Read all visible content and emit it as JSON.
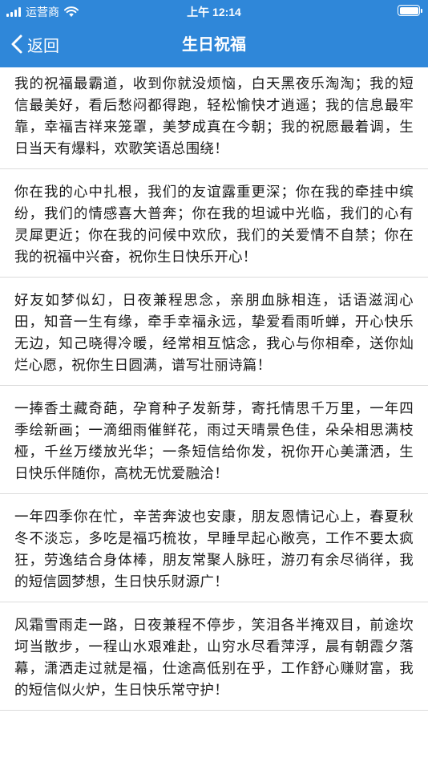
{
  "status_bar": {
    "carrier": "运营商",
    "time": "上午 12:14",
    "icons": [
      "signal-icon",
      "wifi-icon",
      "battery-icon"
    ]
  },
  "nav": {
    "back_label": "返回",
    "title": "生日祝福",
    "icons": [
      "chevron-left-icon"
    ]
  },
  "colors": {
    "accent": "#2f87d9",
    "text": "#1b1b1b",
    "divider": "#dcdcdc"
  },
  "messages": [
    "我的祝福最霸道，收到你就没烦恼，白天黑夜乐淘淘；我的短信最美好，看后愁闷都得跑，轻松愉快才逍遥；我的信息最牢靠，幸福吉祥来笼罩，美梦成真在今朝；我的祝愿最着调，生日当天有爆料，欢歌笑语总围绕！",
    "你在我的心中扎根，我们的友谊露重更深；你在我的牵挂中缤纷，我们的情感喜大普奔；你在我的坦诚中光临，我们的心有灵犀更近；你在我的问候中欢欣，我们的关爱情不自禁；你在我的祝福中兴奋，祝你生日快乐开心！",
    "好友如梦似幻，日夜兼程思念，亲朋血脉相连，话语滋润心田，知音一生有缘，牵手幸福永远，挚爱看雨听蝉，开心快乐无边，知己晓得冷暖，经常相互惦念，我心与你相牵，送你灿烂心愿，祝你生日圆满，谱写壮丽诗篇！",
    "一捧香土藏奇葩，孕育种子发新芽，寄托情思千万里，一年四季绘新画；一滴细雨催鲜花，雨过天晴景色佳，朵朵相思满枝桠，千丝万缕放光华；一条短信给你发，祝你开心美潇洒，生日快乐伴随你，高枕无忧爱融洽！",
    "一年四季你在忙，辛苦奔波也安康，朋友恩情记心上，春夏秋冬不淡忘，多吃是福巧梳妆，早睡早起心敞亮，工作不要太疯狂，劳逸结合身体棒，朋友常聚人脉旺，游刃有余尽徜徉，我的短信圆梦想，生日快乐财源广！",
    "风霜雪雨走一路，日夜兼程不停步，笑泪各半掩双目，前途坎坷当散步，一程山水艰难赴，山穷水尽看萍浮，晨有朝霞夕落幕，潇洒走过就是福，仕途高低别在乎，工作舒心赚财富，我的短信似火炉，生日快乐常守护！"
  ]
}
